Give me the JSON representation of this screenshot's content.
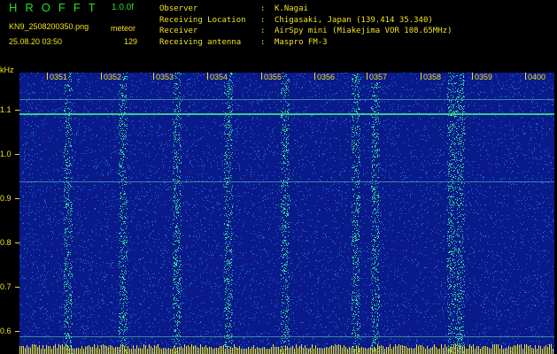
{
  "app": {
    "title": "HROFFT",
    "version": "1.0.0f",
    "filename": "KN9_2508200350.png",
    "mode": "meteor",
    "datetime": "25.08.20 03:50",
    "count": "129"
  },
  "info": [
    {
      "key": "Observer",
      "sep": ":",
      "value": "K.Nagai"
    },
    {
      "key": "Receiving Location",
      "sep": ":",
      "value": "Chigasaki, Japan (139.414 35.340)"
    },
    {
      "key": "Receiver",
      "sep": ":",
      "value": "AirSpy mini (Miakejima VOR 108.65MHz)"
    },
    {
      "key": "Receiving antenna",
      "sep": ":",
      "value": "Maspro FM-3"
    }
  ],
  "spectrogram": {
    "freq_unit": "kHz",
    "freq_labels": [
      "1.1",
      "1.0",
      "0.9",
      "0.8",
      "0.7",
      "0.6"
    ],
    "time_labels": [
      "0351",
      "0352",
      "0353",
      "0354",
      "0355",
      "0356",
      "0357",
      "0358",
      "0359",
      "0400"
    ],
    "colors": {
      "background": "#0a1a8a",
      "noise": "#1e6cd8",
      "signal": "#38e08c",
      "strong": "#e6f04a",
      "baseline": "#f2e21e"
    }
  }
}
